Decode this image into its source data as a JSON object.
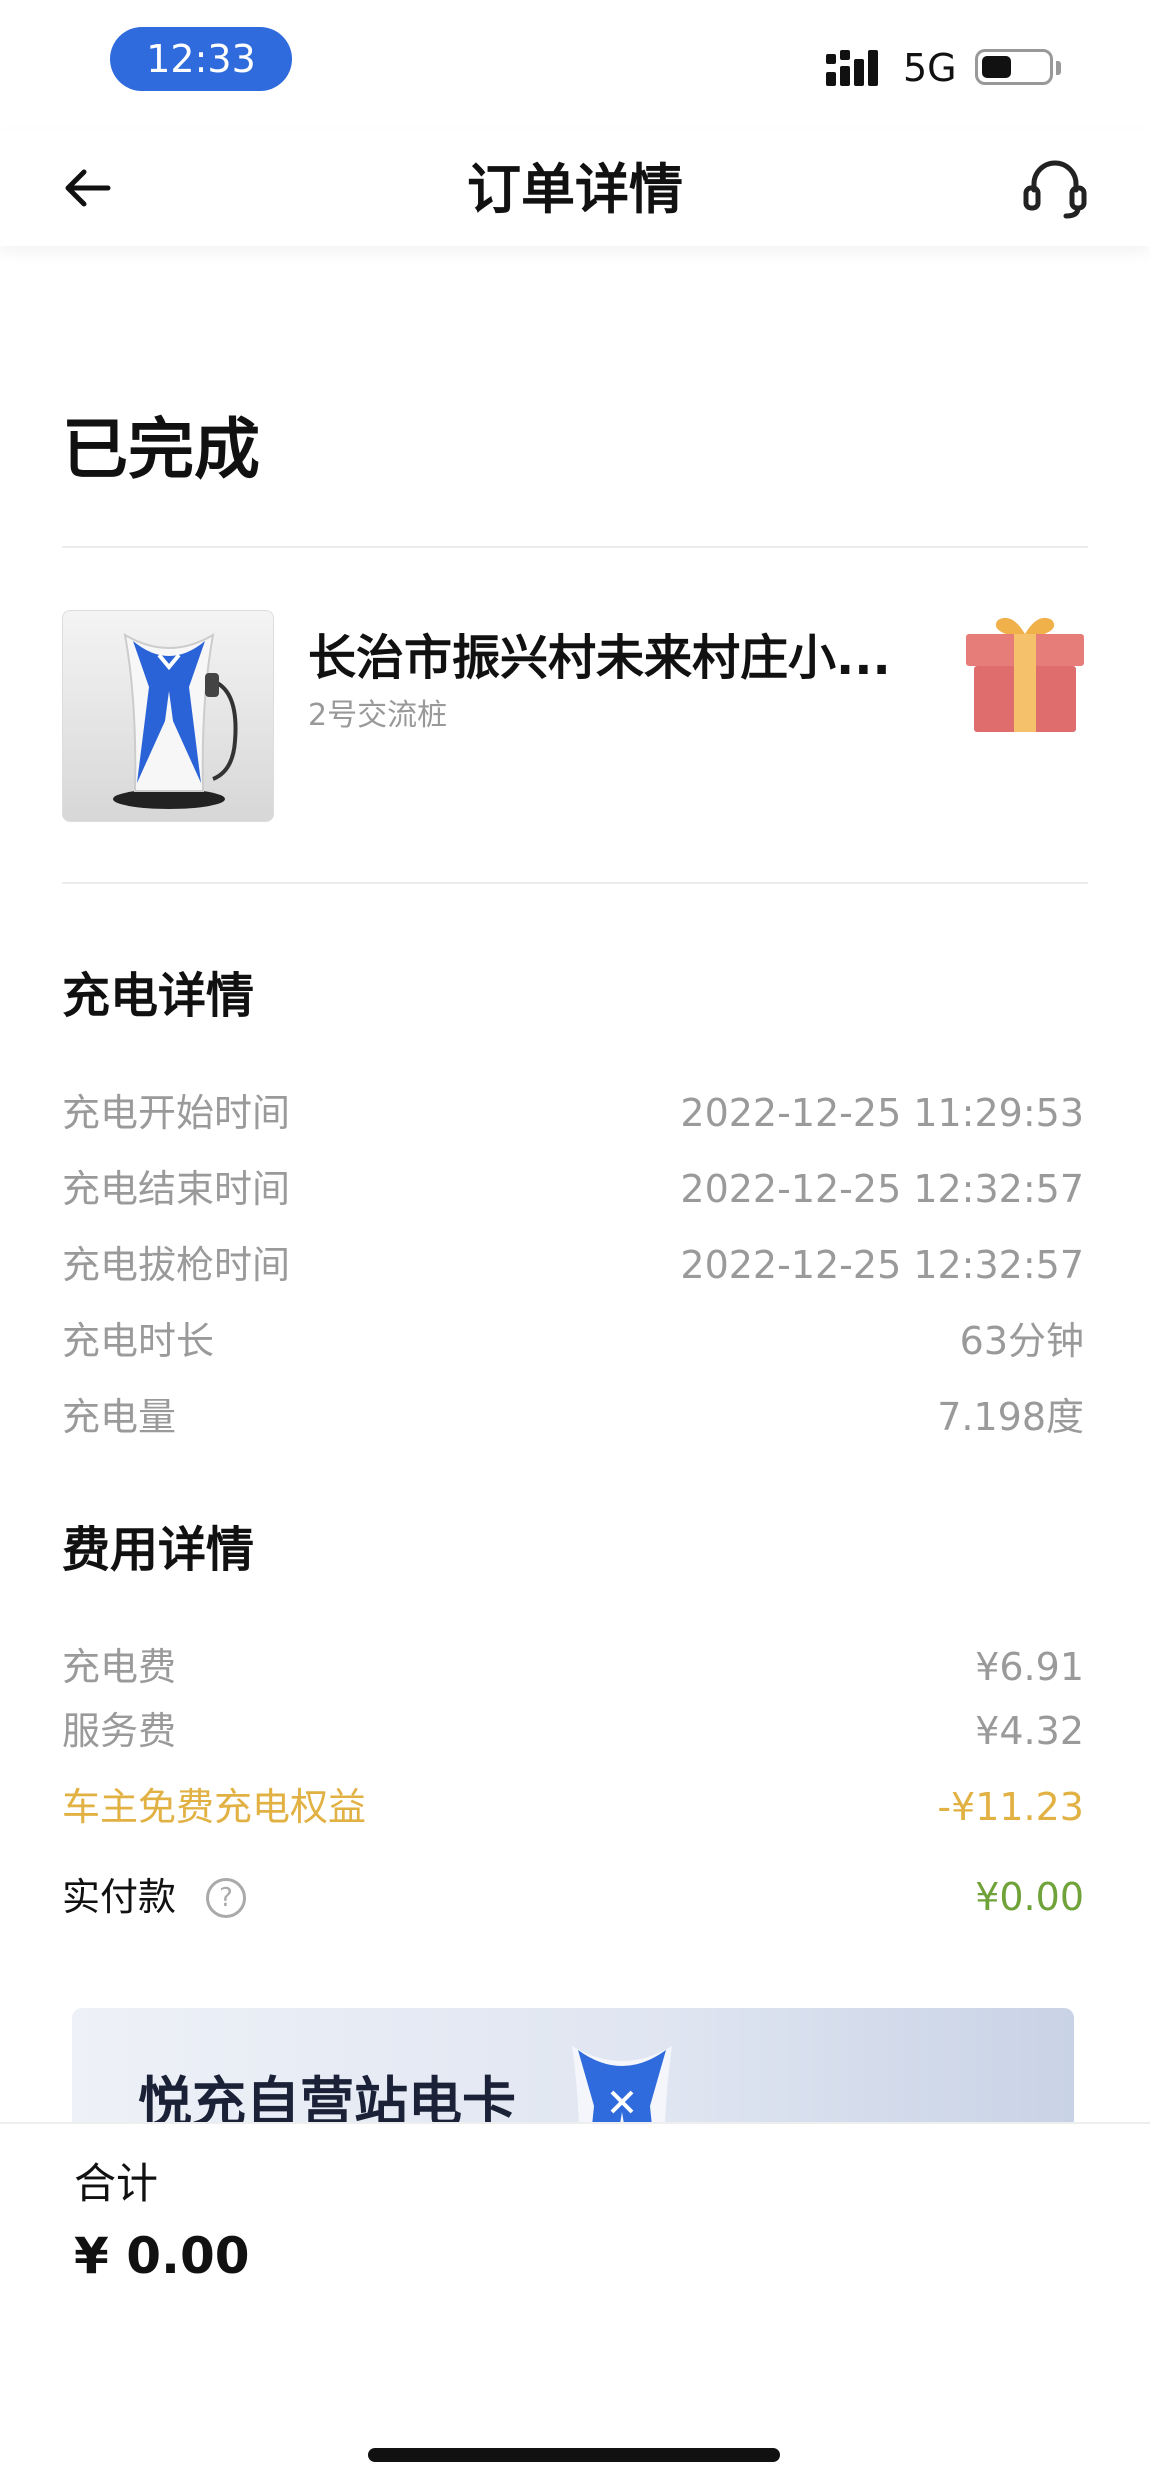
{
  "status_bar": {
    "time": "12:33",
    "network": "5G",
    "battery_level": 0.45
  },
  "nav": {
    "title": "订单详情"
  },
  "order": {
    "status": "已完成"
  },
  "station": {
    "name": "长治市振兴村未来村庄小...",
    "pile": "2号交流桩"
  },
  "charging": {
    "title": "充电详情",
    "rows": [
      {
        "label": "充电开始时间",
        "value": "2022-12-25 11:29:53"
      },
      {
        "label": "充电结束时间",
        "value": "2022-12-25 12:32:57"
      },
      {
        "label": "充电拔枪时间",
        "value": "2022-12-25 12:32:57"
      },
      {
        "label": "充电时长",
        "value": "63分钟"
      },
      {
        "label": "充电量",
        "value": "7.198度"
      }
    ]
  },
  "fees": {
    "title": "费用详情",
    "rows": [
      {
        "label": "充电费",
        "value": "¥6.91"
      },
      {
        "label": "服务费",
        "value": "¥4.32"
      },
      {
        "label": "车主免费充电权益",
        "value": "-¥11.23"
      }
    ],
    "paid_label": "实付款",
    "paid_value": "¥0.00",
    "help_glyph": "?"
  },
  "promo": {
    "title": "悦充自营站电卡"
  },
  "footer": {
    "total_label": "合计",
    "total_value": "¥ 0.00"
  },
  "colors": {
    "accent_blue": "#2f6bdc",
    "discount_gold": "#e2b143",
    "paid_green": "#6fa33a"
  },
  "icons": {
    "back": "arrow-left-icon",
    "support": "headset-icon",
    "gift": "gift-icon",
    "help": "question-circle-icon"
  }
}
